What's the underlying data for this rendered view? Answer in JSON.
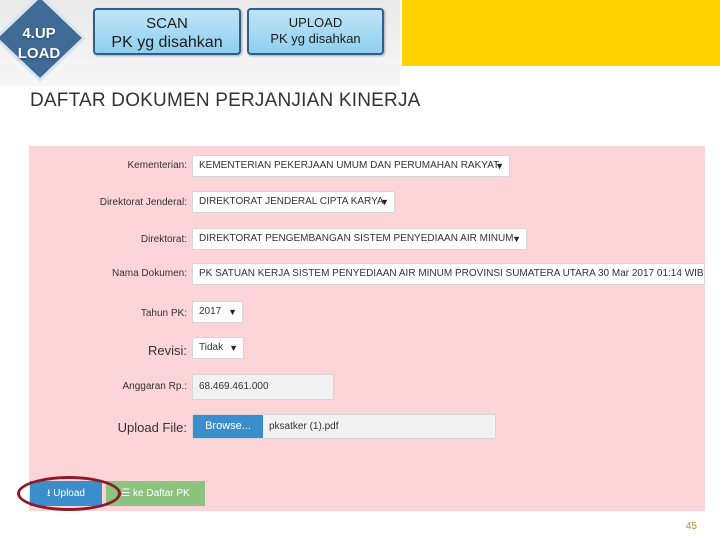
{
  "banner": {
    "step_label_line1": "4.UP",
    "step_label_line2": "LOAD",
    "scan_line1": "SCAN",
    "scan_line2": "PK  yg disahkan",
    "upload_line1": "UPLOAD",
    "upload_line2": "PK yg disahkan",
    "accent_color": "#ffd200"
  },
  "page_title": "DAFTAR DOKUMEN PERJANJIAN KINERJA",
  "form": {
    "kementerian": {
      "label": "Kementerian:",
      "value": "KEMENTERIAN PEKERJAAN UMUM DAN PERUMAHAN RAKYAT"
    },
    "direktorat_jenderal": {
      "label": "Direktorat Jenderal:",
      "value": "DIREKTORAT JENDERAL CIPTA KARYA"
    },
    "direktorat": {
      "label": "Direktorat:",
      "value": "DIREKTORAT PENGEMBANGAN SISTEM PENYEDIAAN AIR MINUM"
    },
    "nama_dokumen": {
      "label": "Nama Dokumen:",
      "value": "PK SATUAN KERJA SISTEM PENYEDIAAN AIR MINUM PROVINSI SUMATERA UTARA 30 Mar 2017 01:14 WIB"
    },
    "tahun_pk": {
      "label": "Tahun PK:",
      "value": "2017"
    },
    "revisi": {
      "label": "Revisi:",
      "value": "Tidak"
    },
    "anggaran": {
      "label": "Anggaran Rp.:",
      "value": "68.469.461.000"
    },
    "upload_file": {
      "label": "Upload File:",
      "browse_label": "Browse...",
      "file_name": "pksatker (1).pdf"
    }
  },
  "actions": {
    "upload_label": "Upload",
    "back_label": "ke Daftar PK"
  },
  "page_number": "45",
  "colors": {
    "panel_bg": "#fdd5d8",
    "primary_button": "#3c8dcb",
    "secondary_button": "#8dc27f",
    "highlight": "#8b1a2b"
  }
}
